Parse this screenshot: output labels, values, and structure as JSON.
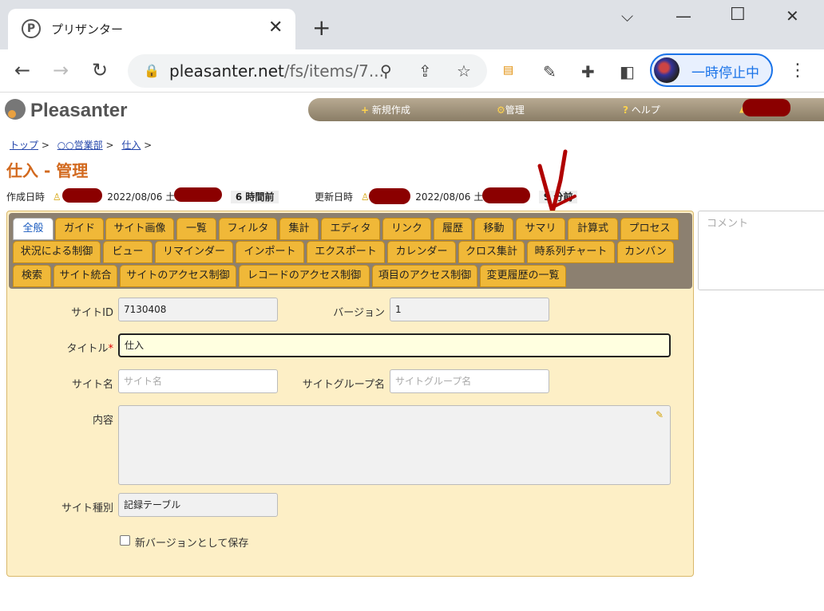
{
  "browser": {
    "tab_title": "プリザンター",
    "url_host": "pleasanter.net",
    "url_path": "/fs/items/7...",
    "profile_status": "一時停止中"
  },
  "app": {
    "logo_text": "Pleasanter",
    "nav": {
      "new_item": "新規作成",
      "manage": "管理",
      "help": "ヘルプ"
    }
  },
  "breadcrumb": [
    "トップ",
    "○○営業部",
    "仕入"
  ],
  "page_title": "仕入 - 管理",
  "meta": {
    "created_label": "作成日時",
    "created_date": "2022/08/06 土",
    "created_ago": "6 時間前",
    "updated_label": "更新日時",
    "updated_date": "2022/08/06 土",
    "updated_ago": "9 分前"
  },
  "tabs": [
    "全般",
    "ガイド",
    "サイト画像",
    "一覧",
    "フィルタ",
    "集計",
    "エディタ",
    "リンク",
    "履歴",
    "移動",
    "サマリ",
    "計算式",
    "プロセス",
    "状況による制御",
    "ビュー",
    "リマインダー",
    "インポート",
    "エクスポート",
    "カレンダー",
    "クロス集計",
    "時系列チャート",
    "カンバン",
    "検索",
    "サイト統合",
    "サイトのアクセス制御",
    "レコードのアクセス制御",
    "項目のアクセス制御",
    "変更履歴の一覧"
  ],
  "active_tab": "全般",
  "form": {
    "site_id_label": "サイトID",
    "site_id_value": "7130408",
    "version_label": "バージョン",
    "version_value": "1",
    "title_label": "タイトル",
    "title_required_mark": "*",
    "title_value": "仕入",
    "site_name_label": "サイト名",
    "site_name_placeholder": "サイト名",
    "site_group_label": "サイトグループ名",
    "site_group_placeholder": "サイトグループ名",
    "content_label": "内容",
    "site_type_label": "サイト種別",
    "site_type_value": "記録テーブル",
    "save_new_version_label": "新バージョンとして保存"
  },
  "comment_placeholder": "コメント",
  "colors": {
    "accent": "#d2691e",
    "tab": "#f0b838",
    "panel": "#fdefc6"
  }
}
